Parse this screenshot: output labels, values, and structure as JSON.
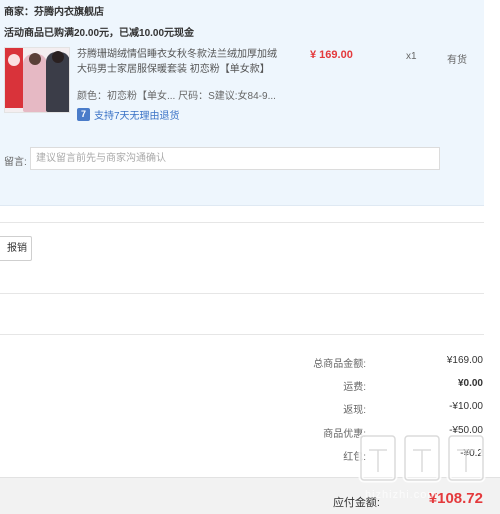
{
  "shop": {
    "name": "商家：芬腾内衣旗舰店",
    "promo": "活动商品已购满20.00元，已减10.00元现金"
  },
  "item": {
    "title": "芬腾珊瑚绒情侣睡衣女秋冬款法兰绒加厚加绒大码男士家居服保暖套装 初恋粉【单女款】",
    "spec": "颜色：初恋粉【单女...   尺码：S建议:女84-9...",
    "price": "¥ 169.00",
    "qty": "x1",
    "stock": "有货",
    "guarantee": "支持7天无理由退货",
    "guarantee_icon": "7"
  },
  "note": {
    "label": "留言:",
    "placeholder": "建议留言前先与商家沟通确认"
  },
  "invoice": {
    "button_label": "报销"
  },
  "summary": [
    {
      "label": "总商品金额:",
      "value": "¥169.00",
      "bold": false
    },
    {
      "label": "运费:",
      "value": "¥0.00",
      "bold": true
    },
    {
      "label": "返现:",
      "value": "-¥10.00",
      "bold": false
    },
    {
      "label": "商品优惠:",
      "value": "-¥50.00",
      "bold": false
    },
    {
      "label": "红包:",
      "value": "-¥0.2",
      "bold": false
    }
  ],
  "footer": {
    "total_label": "应付金额:",
    "total_value": "¥108.72"
  },
  "watermark": {
    "text": "值 什么值得买",
    "domain": "hizhizhi.com"
  },
  "colors": {
    "accent_red": "#e4393c",
    "panel_blue": "#eef6fd",
    "link_blue": "#3a72c6"
  }
}
